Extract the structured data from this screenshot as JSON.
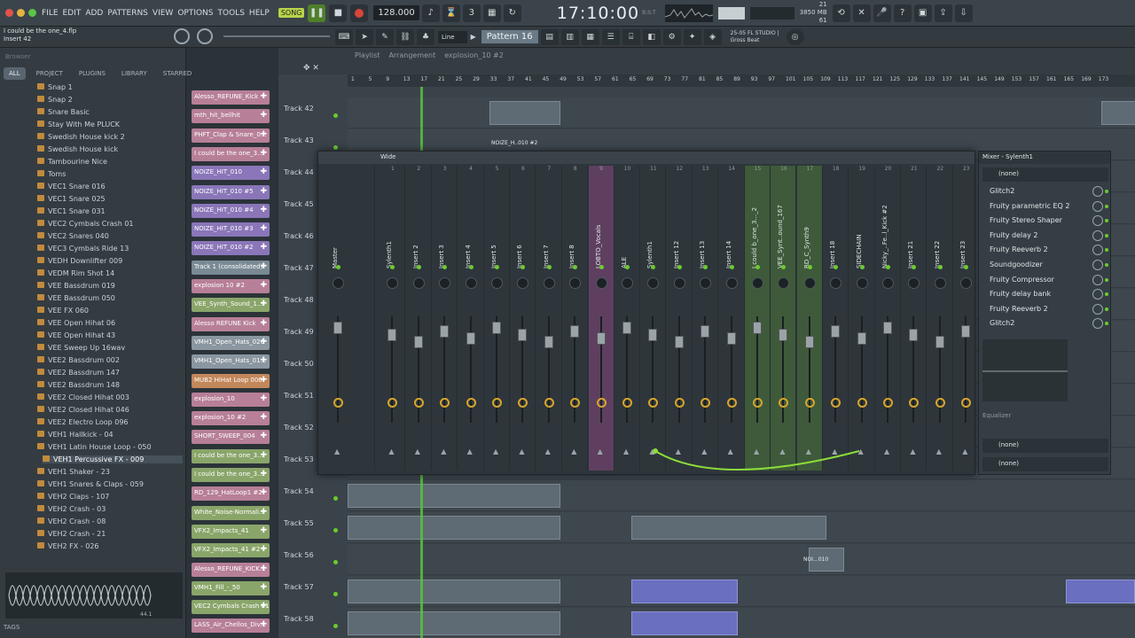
{
  "menu": [
    "FILE",
    "EDIT",
    "ADD",
    "PATTERNS",
    "VIEW",
    "OPTIONS",
    "TOOLS",
    "HELP"
  ],
  "song_button": "SONG",
  "tempo": "128.000",
  "time": "17:10:00",
  "time_sub": "B:S:T",
  "cpu": {
    "cpu": "21",
    "mem": "3850 MB",
    "poly": "61"
  },
  "hint": {
    "line1": "I could be the one_4.flp",
    "line2": "Insert 42"
  },
  "snap": "Line",
  "pattern": "Pattern 16",
  "news": {
    "line1": "25-05  FL STUDIO |",
    "line2": "Gross Beat"
  },
  "browser": {
    "search_placeholder": "Browser",
    "tabs": [
      "ALL",
      "PROJECT",
      "PLUGINS",
      "LIBRARY",
      "STARRED"
    ],
    "items": [
      "Snap 1",
      "Snap 2",
      "Snare Basic",
      "Stay With Me PLUCK",
      "Swedish House kick 2",
      "Swedish House kick",
      "Tambourine Nice",
      "Toms",
      "VEC1 Snare 016",
      "VEC1 Snare 025",
      "VEC1 Snare 031",
      "VEC2 Cymbals Crash 01",
      "VEC2 Snares 040",
      "VEC3 Cymbals Ride 13",
      "VEDH Downlifter 009",
      "VEDM Rim Shot 14",
      "VEE Bassdrum 019",
      "VEE Bassdrum 050",
      "VEE FX 060",
      "VEE Open Hihat 06",
      "VEE Open Hihat 43",
      "VEE Sweep Up 16wav",
      "VEE2 Bassdrum 002",
      "VEE2 Bassdrum 147",
      "VEE2 Bassdrum 148",
      "VEE2 Closed Hihat 003",
      "VEE2 Closed Hihat 046",
      "VEE2 Electro Loop 096",
      "VEH1 Hallkick - 04",
      "VEH1 Latin House Loop - 050",
      "VEH1 Percussive FX - 009",
      "VEH1 Shaker - 23",
      "VEH1 Snares & Claps - 059",
      "VEH2 Claps - 107",
      "VEH2 Crash - 03",
      "VEH2 Crash - 08",
      "VEH2 Crash - 21",
      "VEH2 FX - 026"
    ],
    "selected": "VEH1 Percussive FX - 009",
    "tags": "TAGS",
    "wave_time": "44.1"
  },
  "channels": [
    {
      "name": "Alesso_REFUNE_Kick",
      "color": "#b77f98"
    },
    {
      "name": "mth_hit_bellhit",
      "color": "#b77f98"
    },
    {
      "name": "PHFT_Clap & Snare_0...",
      "color": "#b77f98"
    },
    {
      "name": "I could be the one_3...",
      "color": "#b77f98"
    },
    {
      "name": "NOIZE_HIT_010",
      "color": "#8a76b8"
    },
    {
      "name": "NOIZE_HIT_010 #5",
      "color": "#8a76b8"
    },
    {
      "name": "NOIZE_HIT_010 #4",
      "color": "#8a76b8"
    },
    {
      "name": "NOIZE_HIT_010 #3",
      "color": "#8a76b8"
    },
    {
      "name": "NOIZE_HIT_010 #2",
      "color": "#8a76b8"
    },
    {
      "name": "Track 1 (consolidated)",
      "color": "#7a8a95"
    },
    {
      "name": "explosion 10 #2",
      "color": "#b77f98"
    },
    {
      "name": "VEE_Synth_Sound_1...",
      "color": "#8aa56a"
    },
    {
      "name": "Alesso REFUNE Kick",
      "color": "#b77f98"
    },
    {
      "name": "VMH1_Open_Hats_026",
      "color": "#8a96a0"
    },
    {
      "name": "VMH1_Open_Hats_01...",
      "color": "#8a96a0"
    },
    {
      "name": "MUB2 HiHat Loop 006",
      "color": "#c2875a"
    },
    {
      "name": "explosion_10",
      "color": "#b77f98"
    },
    {
      "name": "explosion_10 #2",
      "color": "#b77f98"
    },
    {
      "name": "SHORT_SWEEP_004",
      "color": "#b77f98"
    },
    {
      "name": "I could be the one_3...",
      "color": "#8aa56a"
    },
    {
      "name": "I could be the one_3...",
      "color": "#8aa56a"
    },
    {
      "name": "RD_129_HatLoop1 #2",
      "color": "#b77f98"
    },
    {
      "name": "White_Noise-Normali...",
      "color": "#8aa56a"
    },
    {
      "name": "VFX2_Impacts_41",
      "color": "#8aa56a"
    },
    {
      "name": "VFX2_Impacts_41 #2",
      "color": "#8aa56a"
    },
    {
      "name": "Alesso_REFUNE_KICK...",
      "color": "#b77f98"
    },
    {
      "name": "VMH1_Fill_-_50",
      "color": "#8aa56a"
    },
    {
      "name": "VEC2 Cymbals Crash 01",
      "color": "#8aa56a"
    },
    {
      "name": "LASS_Air_Chellos_Div...",
      "color": "#b77f98"
    }
  ],
  "playlist": {
    "breadcrumb": [
      "Playlist",
      "Arrangement",
      "explosion_10 #2"
    ],
    "ruler": [
      "1",
      "5",
      "9",
      "13",
      "17",
      "21",
      "25",
      "29",
      "33",
      "37",
      "41",
      "45",
      "49",
      "53",
      "57",
      "61",
      "65",
      "69",
      "73",
      "77",
      "81",
      "85",
      "89",
      "93",
      "97",
      "101",
      "105",
      "109",
      "113",
      "117",
      "121",
      "125",
      "129",
      "133",
      "137",
      "141",
      "145",
      "149",
      "153",
      "157",
      "161",
      "165",
      "169",
      "173"
    ],
    "tracks": [
      "Track 42",
      "Track 43",
      "Track 44",
      "Track 45",
      "Track 46",
      "Track 47",
      "Track 48",
      "Track 49",
      "Track 50",
      "Track 51",
      "Track 52",
      "Track 53",
      "Track 54",
      "Track 55",
      "Track 56",
      "Track 57",
      "Track 58"
    ],
    "clip_labels": [
      "NOIZE_H..010 #2",
      "NOI...010"
    ]
  },
  "mixer": {
    "title": "Mixer - Sylenth1",
    "preset": "Wide",
    "strips": [
      {
        "num": "",
        "name": "Master"
      },
      {
        "num": "1",
        "name": "Sylenth1"
      },
      {
        "num": "2",
        "name": "Insert 2"
      },
      {
        "num": "3",
        "name": "Insert 3"
      },
      {
        "num": "4",
        "name": "Insert 4"
      },
      {
        "num": "5",
        "name": "Insert 5"
      },
      {
        "num": "6",
        "name": "Insert 6"
      },
      {
        "num": "7",
        "name": "Insert 7"
      },
      {
        "num": "8",
        "name": "Insert 8"
      },
      {
        "num": "9",
        "name": "LOBTO_Vocals"
      },
      {
        "num": "10",
        "name": "ALE"
      },
      {
        "num": "11",
        "name": "Sylenth1"
      },
      {
        "num": "12",
        "name": "Insert 12"
      },
      {
        "num": "13",
        "name": "Insert 13"
      },
      {
        "num": "14",
        "name": "Insert 14"
      },
      {
        "num": "15",
        "name": "I could b_one_3..._2"
      },
      {
        "num": "16",
        "name": "VEE_Synt..ound_167"
      },
      {
        "num": "17",
        "name": "RD_C_Synth9"
      },
      {
        "num": "18",
        "name": "Insert 18"
      },
      {
        "num": "19",
        "name": "SIDECHAIN"
      },
      {
        "num": "20",
        "name": "Nicky_..Fe..l_Kick #2"
      },
      {
        "num": "21",
        "name": "Insert 21"
      },
      {
        "num": "22",
        "name": "Insert 22"
      },
      {
        "num": "23",
        "name": "Insert 23"
      }
    ],
    "input": "(none)",
    "slots": [
      "Glitch2",
      "Fruity parametric EQ 2",
      "Fruity Stereo Shaper",
      "Fruity delay 2",
      "Fruity Reeverb 2",
      "Soundgoodizer",
      "Fruity Compressor",
      "Fruity delay bank",
      "Fruity Reeverb 2",
      "Glitch2"
    ],
    "eq_label": "Equalizer",
    "out1": "(none)",
    "out2": "(none)"
  },
  "colors": {
    "accent_green": "#6ccb2f",
    "playhead": "#58c23b",
    "panel": "#2e363b"
  }
}
